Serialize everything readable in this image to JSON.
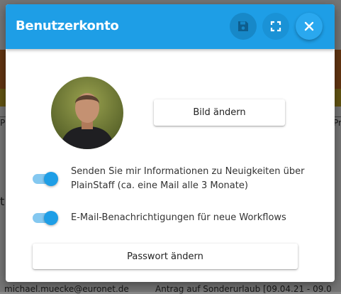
{
  "background": {
    "left_fragment": "P",
    "right_fragment": "Pr",
    "middle_fragment": "t",
    "footer_email": "michael.muecke@euronet.de",
    "footer_request": "Antrag auf Sonderurlaub [09.04.21 - 09.0"
  },
  "dialog": {
    "title": "Benutzerkonto",
    "header_icons": [
      "save-icon",
      "fullscreen-icon",
      "close-icon"
    ],
    "change_picture_label": "Bild ändern",
    "options": [
      {
        "label": "Senden Sie mir Informationen zu Neuigkeiten über PlainStaff (ca. eine Mail alle 3 Monate)",
        "enabled": true
      },
      {
        "label": "E-Mail-Benachrichtigungen für neue Workflows",
        "enabled": true
      }
    ],
    "change_password_label": "Passwort ändern"
  },
  "colors": {
    "accent": "#1e9ee6",
    "toggle_track": "#84c8f0"
  }
}
